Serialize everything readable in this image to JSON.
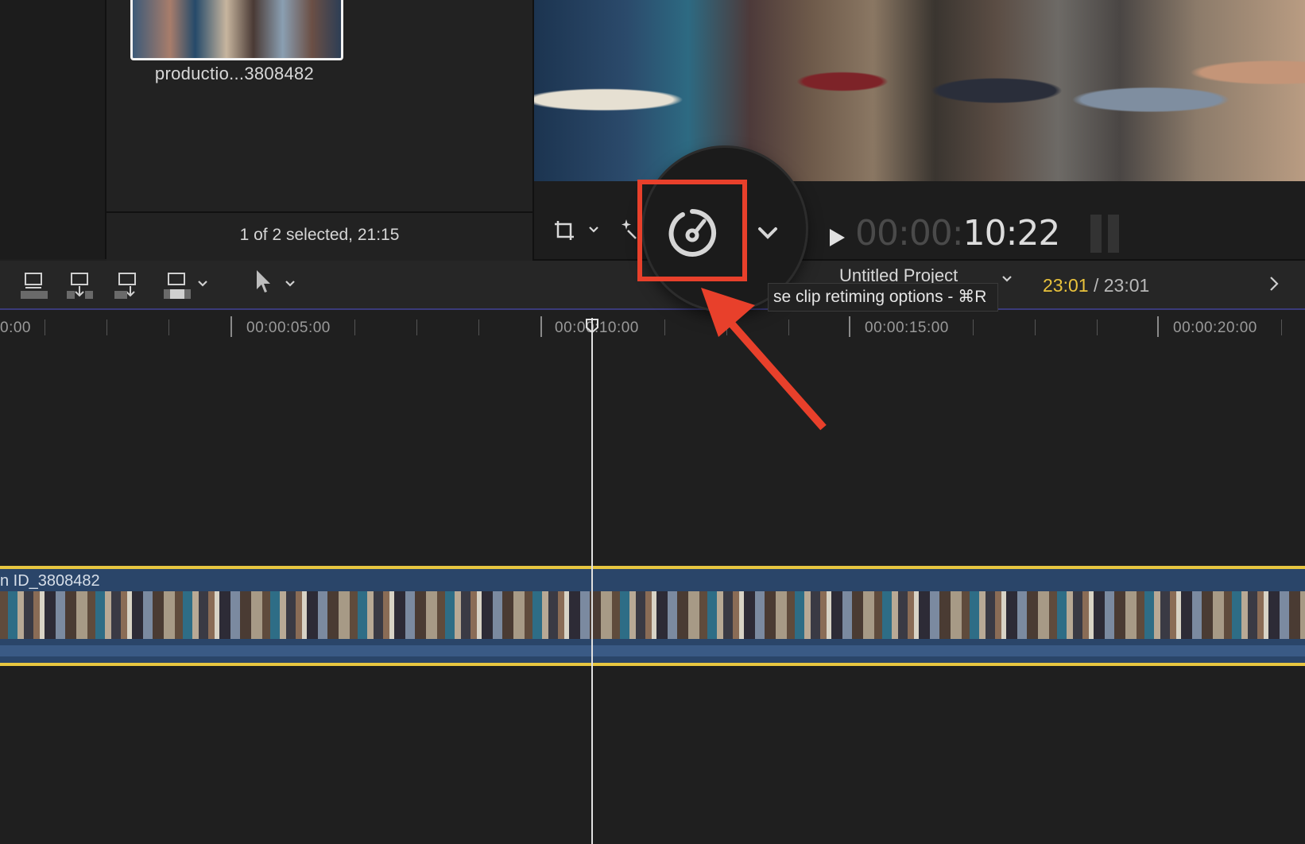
{
  "browser": {
    "thumbnail_name": "productio...3808482",
    "selection_status": "1 of 2 selected, 21:15"
  },
  "viewer": {
    "timecode_dim": "00:00:",
    "timecode_bright": "10:22"
  },
  "toolbar": {
    "project_name": "Untitled Project",
    "duration_current": "23:01",
    "duration_separator": " / ",
    "duration_total": "23:01"
  },
  "tooltip": {
    "text": "se clip retiming options - ⌘R"
  },
  "ruler": {
    "labels": [
      "0:00",
      "00:00:05:00",
      "00:00:10:00",
      "00:00:15:00",
      "00:00:20:00"
    ]
  },
  "timeline": {
    "clip_name": "n ID_3808482"
  },
  "colors": {
    "highlight": "#e8402b",
    "clip_border": "#e7c640",
    "duration_current": "#e9c23c",
    "clip_fill": "#2a4569"
  },
  "icons": {
    "retime": "speedometer-icon",
    "transform": "crop-transform-icon",
    "enhance": "magic-wand-icon",
    "play": "play-icon",
    "append": "append-clip-icon",
    "insert": "insert-clip-icon",
    "connect": "connect-clip-icon",
    "overwrite": "overwrite-clip-icon",
    "select_tool": "arrow-pointer-icon"
  }
}
